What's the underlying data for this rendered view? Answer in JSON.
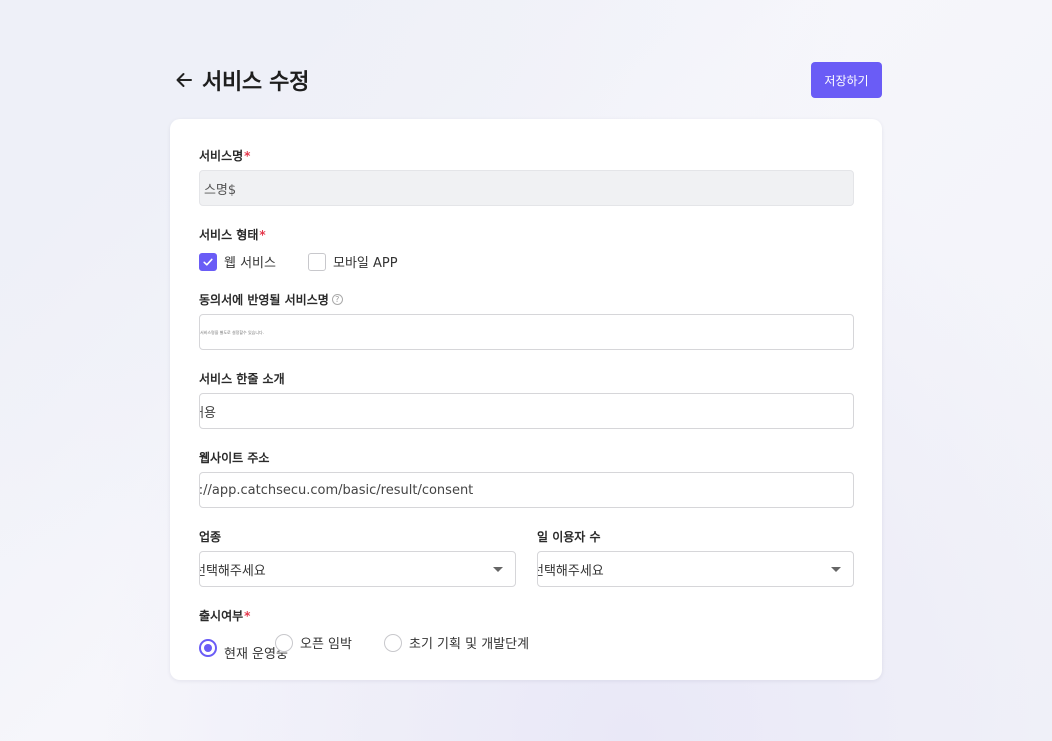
{
  "header": {
    "title": "서비스 수정",
    "save_label": "저장하기"
  },
  "form": {
    "service_name": {
      "label": "서비스명",
      "required_mark": "*",
      "value": "ㅣ스명$"
    },
    "service_type": {
      "label": "서비스 형태",
      "required_mark": "*",
      "options": [
        {
          "label": "웹 서비스",
          "checked": true
        },
        {
          "label": "모바일 APP",
          "checked": false
        }
      ]
    },
    "consent_name": {
      "label": "동의서에 반영될 서비스명",
      "help_icon": "question-circle-icon",
      "placeholder": "서비스명을 별도로 설정할수 있습니다."
    },
    "intro": {
      "label": "서비스 한줄 소개",
      "value": "내용"
    },
    "website": {
      "label": "웹사이트 주소",
      "value": "s://app.catchsecu.com/basic/result/consent"
    },
    "industry": {
      "label": "업종",
      "selected": "선택해주세요"
    },
    "daily_users": {
      "label": "일 이용자 수",
      "selected": "선택해주세요"
    },
    "release": {
      "label": "출시여부",
      "required_mark": "*",
      "options": [
        {
          "label": "현재 운영중",
          "checked": true
        },
        {
          "label": "오픈 임박",
          "checked": false
        },
        {
          "label": "초기 기획 및 개발단계",
          "checked": false
        }
      ]
    }
  },
  "colors": {
    "accent": "#6a5cf6",
    "required": "#e5384c"
  }
}
